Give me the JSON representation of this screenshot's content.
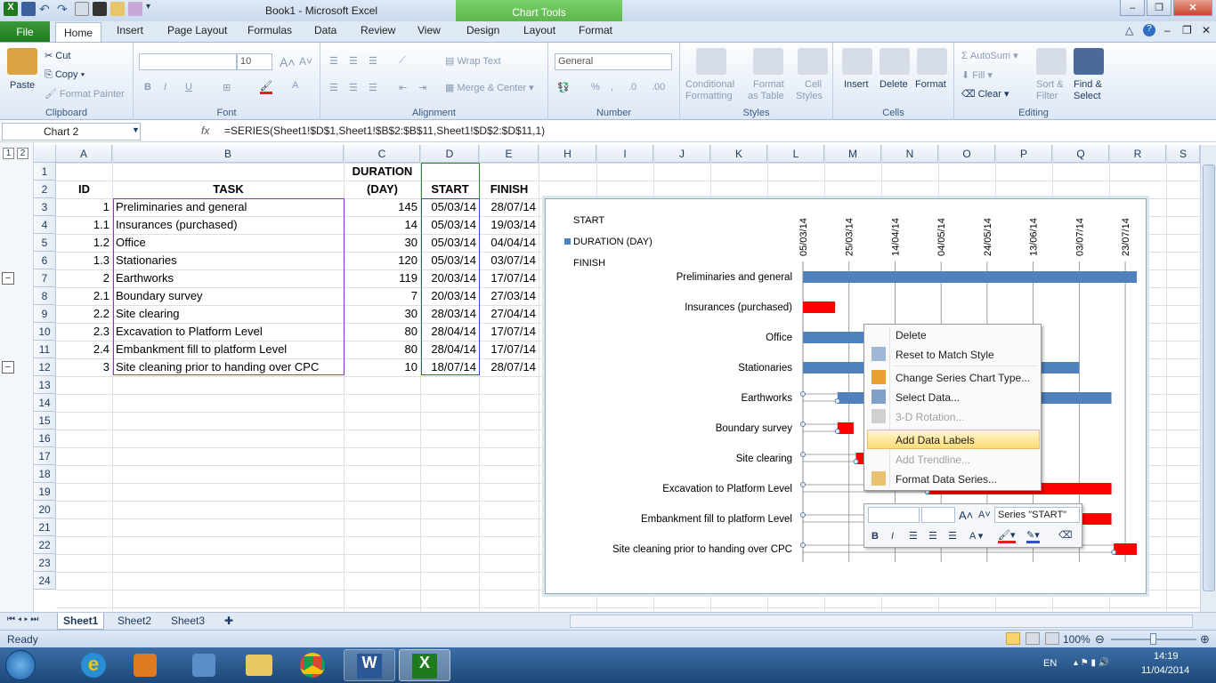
{
  "window": {
    "title": "Book1  -  Microsoft Excel",
    "context_tab": "Chart Tools"
  },
  "tabs": [
    "File",
    "Home",
    "Insert",
    "Page Layout",
    "Formulas",
    "Data",
    "Review",
    "View",
    "Design",
    "Layout",
    "Format"
  ],
  "ribbon": {
    "clipboard": {
      "paste": "Paste",
      "cut": "Cut",
      "copy": "Copy",
      "format_painter": "Format Painter",
      "label": "Clipboard"
    },
    "font": {
      "size": "10",
      "label": "Font"
    },
    "alignment": {
      "wrap": "Wrap Text",
      "merge": "Merge & Center",
      "label": "Alignment"
    },
    "number": {
      "format": "General",
      "label": "Number"
    },
    "styles": {
      "cond": "Conditional",
      "cond2": "Formatting",
      "table": "Format",
      "table2": "as Table",
      "cell": "Cell",
      "cell2": "Styles",
      "label": "Styles"
    },
    "cells": {
      "insert": "Insert",
      "delete": "Delete",
      "format": "Format",
      "label": "Cells"
    },
    "editing": {
      "autosum": "AutoSum",
      "fill": "Fill",
      "clear": "Clear",
      "sort": "Sort &",
      "sort2": "Filter",
      "find": "Find &",
      "find2": "Select",
      "label": "Editing"
    }
  },
  "formula_bar": {
    "name_box": "Chart 2",
    "fx": "fx",
    "formula": "=SERIES(Sheet1!$D$1,Sheet1!$B$2:$B$11,Sheet1!$D$2:$D$11,1)"
  },
  "outline_levels": [
    "1",
    "2"
  ],
  "columns": [
    "A",
    "B",
    "C",
    "D",
    "E",
    "H",
    "I",
    "J",
    "K",
    "L",
    "M",
    "N",
    "O",
    "P",
    "Q",
    "R",
    "S"
  ],
  "header_row": {
    "id": "ID",
    "task": "TASK",
    "duration1": "DURATION",
    "duration2": "(DAY)",
    "start": "START",
    "finish": "FINISH"
  },
  "rows": [
    {
      "id": "1",
      "task": "Preliminaries and general",
      "dur": "145",
      "start": "05/03/14",
      "finish": "28/07/14"
    },
    {
      "id": "1.1",
      "task": "Insurances (purchased)",
      "dur": "14",
      "start": "05/03/14",
      "finish": "19/03/14"
    },
    {
      "id": "1.2",
      "task": "Office",
      "dur": "30",
      "start": "05/03/14",
      "finish": "04/04/14"
    },
    {
      "id": "1.3",
      "task": "Stationaries",
      "dur": "120",
      "start": "05/03/14",
      "finish": "03/07/14"
    },
    {
      "id": "2",
      "task": "Earthworks",
      "dur": "119",
      "start": "20/03/14",
      "finish": "17/07/14"
    },
    {
      "id": "2.1",
      "task": "Boundary survey",
      "dur": "7",
      "start": "20/03/14",
      "finish": "27/03/14"
    },
    {
      "id": "2.2",
      "task": "Site clearing",
      "dur": "30",
      "start": "28/03/14",
      "finish": "27/04/14"
    },
    {
      "id": "2.3",
      "task": "Excavation to Platform Level",
      "dur": "80",
      "start": "28/04/14",
      "finish": "17/07/14"
    },
    {
      "id": "2.4",
      "task": "Embankment fill to platform Level",
      "dur": "80",
      "start": "28/04/14",
      "finish": "17/07/14"
    },
    {
      "id": "3",
      "task": "Site cleaning prior to handing over CPC",
      "dur": "10",
      "start": "18/07/14",
      "finish": "28/07/14"
    }
  ],
  "row_numbers": [
    "1",
    "2",
    "3",
    "4",
    "5",
    "6",
    "7",
    "8",
    "9",
    "10",
    "11",
    "12",
    "13",
    "14",
    "15",
    "16",
    "17",
    "18",
    "19",
    "20",
    "21",
    "22",
    "23",
    "24"
  ],
  "chart_data": {
    "type": "bar",
    "legend": [
      "START",
      "DURATION (DAY)",
      "FINISH"
    ],
    "legend_placement": "top-left",
    "date_ticks": [
      "05/03/14",
      "25/03/14",
      "14/04/14",
      "04/05/14",
      "24/05/14",
      "13/06/14",
      "03/07/14",
      "23/07/14"
    ],
    "categories": [
      "Preliminaries and general",
      "Insurances (purchased)",
      "Office",
      "Stationaries",
      "Earthworks",
      "Boundary survey",
      "Site clearing",
      "Excavation to Platform Level",
      "Embankment fill to platform Level",
      "Site cleaning prior to handing over CPC"
    ],
    "series": [
      {
        "name": "DURATION (DAY)",
        "values": [
          145,
          14,
          30,
          120,
          119,
          7,
          30,
          80,
          80,
          10
        ]
      }
    ],
    "start": [
      "05/03/14",
      "05/03/14",
      "05/03/14",
      "05/03/14",
      "20/03/14",
      "20/03/14",
      "28/03/14",
      "28/04/14",
      "28/04/14",
      "18/07/14"
    ],
    "bar_colors": [
      "#4f81bd",
      "#ff0000",
      "#4f81bd",
      "#4f81bd",
      "#4f81bd",
      "#ff0000",
      "#ff0000",
      "#ff0000",
      "#ff0000",
      "#ff0000"
    ]
  },
  "context_menu": [
    "Delete",
    "Reset to Match Style",
    "Change Series Chart Type...",
    "Select Data...",
    "3-D Rotation...",
    "Add Data Labels",
    "Add Trendline...",
    "Format Data Series..."
  ],
  "mini_toolbar": {
    "series": "Series \"START\""
  },
  "sheets": [
    "Sheet1",
    "Sheet2",
    "Sheet3"
  ],
  "status": {
    "ready": "Ready",
    "zoom": "100%"
  },
  "taskbar": {
    "lang": "EN",
    "time": "14:19",
    "date": "11/04/2014"
  }
}
